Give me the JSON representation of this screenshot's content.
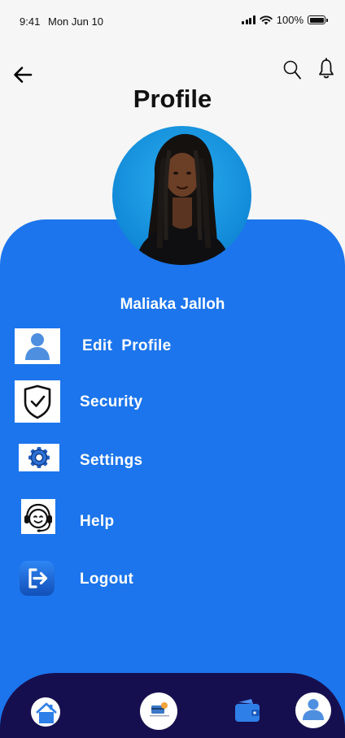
{
  "status_bar": {
    "time": "9:41",
    "date": "Mon Jun 10",
    "battery": "100%"
  },
  "header": {
    "title": "Profile",
    "back_icon": "arrow-left-icon",
    "search_icon": "search-icon",
    "bell_icon": "bell-icon"
  },
  "profile": {
    "name": "Maliaka Jalloh",
    "avatar": "profile-photo"
  },
  "menu": {
    "items": [
      {
        "label": "Edit  Profile",
        "icon": "user-icon"
      },
      {
        "label": "Security",
        "icon": "shield-check-icon"
      },
      {
        "label": "Settings",
        "icon": "gear-icon"
      },
      {
        "label": "Help",
        "icon": "headset-icon"
      },
      {
        "label": "Logout",
        "icon": "logout-icon"
      }
    ]
  },
  "bottom_nav": {
    "items": [
      {
        "icon": "home-icon"
      },
      {
        "icon": "card-app-icon"
      },
      {
        "icon": "wallet-icon"
      },
      {
        "icon": "profile-icon",
        "active": true
      }
    ]
  },
  "colors": {
    "accent_blue": "#1c75ec",
    "nav_dark": "#160f4f",
    "icon_blue": "#4f8fe0",
    "background": "#f6f6f6"
  }
}
